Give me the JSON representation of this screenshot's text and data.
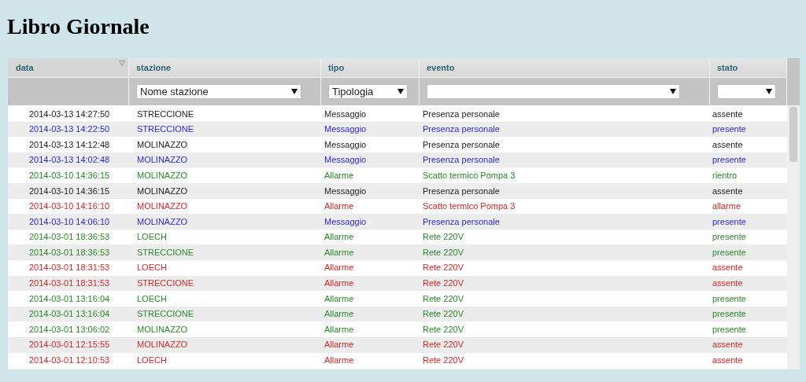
{
  "title": "Libro Giornale",
  "columns": [
    {
      "label": "data",
      "sorted": true
    },
    {
      "label": "stazione",
      "sorted": false,
      "filter": {
        "kind": "select",
        "value": "Nome stazione"
      }
    },
    {
      "label": "tipo",
      "sorted": false,
      "filter": {
        "kind": "select",
        "value": "Tipologia"
      }
    },
    {
      "label": "evento",
      "sorted": false,
      "filter": {
        "kind": "select"
      }
    },
    {
      "label": "stato",
      "sorted": false,
      "filter": {
        "kind": "select"
      }
    }
  ],
  "rows": [
    {
      "color": "#222222",
      "cells": [
        "2014-03-13 14:27:50",
        "STRECCIONE",
        "Messaggio",
        "Presenza personale",
        "assente"
      ]
    },
    {
      "color": "#2a2acc",
      "cells": [
        "2014-03-13 14:22:50",
        "STRECCIONE",
        "Messaggio",
        "Presenza personale",
        "presente"
      ]
    },
    {
      "color": "#222222",
      "cells": [
        "2014-03-13 14:12:48",
        "MOLINAZZO",
        "Messaggio",
        "Presenza personale",
        "assente"
      ]
    },
    {
      "color": "#2a2acc",
      "cells": [
        "2014-03-13 14:02:48",
        "MOLINAZZO",
        "Messaggio",
        "Presenza personale",
        "presente"
      ]
    },
    {
      "color": "#2a8a2a",
      "cells": [
        "2014-03-10 14:36:15",
        "MOLINAZZO",
        "Allarme",
        "Scatto termico Pompa 3",
        "rientro"
      ]
    },
    {
      "color": "#222222",
      "cells": [
        "2014-03-10 14:36:15",
        "MOLINAZZO",
        "Messaggio",
        "Presenza personale",
        "assente"
      ]
    },
    {
      "color": "#d42a2a",
      "cells": [
        "2014-03-10 14:16:10",
        "MOLINAZZO",
        "Allarme",
        "Scatto termico Pompa 3",
        "allarme"
      ]
    },
    {
      "color": "#2a2acc",
      "cells": [
        "2014-03-10 14:06:10",
        "MOLINAZZO",
        "Messaggio",
        "Presenza personale",
        "presente"
      ]
    },
    {
      "color": "#2a8a2a",
      "cells": [
        "2014-03-01 18:36:53",
        "LOECH",
        "Allarme",
        "Rete 220V",
        "presente"
      ]
    },
    {
      "color": "#2a8a2a",
      "cells": [
        "2014-03-01 18:36:53",
        "STRECCIONE",
        "Allarme",
        "Rete 220V",
        "presente"
      ]
    },
    {
      "color": "#d42a2a",
      "cells": [
        "2014-03-01 18:31:53",
        "LOECH",
        "Allarme",
        "Rete 220V",
        "assente"
      ]
    },
    {
      "color": "#d42a2a",
      "cells": [
        "2014-03-01 18:31:53",
        "STRECCIONE",
        "Allarme",
        "Rete 220V",
        "assente"
      ]
    },
    {
      "color": "#2a8a2a",
      "cells": [
        "2014-03-01 13:16:04",
        "LOECH",
        "Allarme",
        "Rete 220V",
        "presente"
      ]
    },
    {
      "color": "#2a8a2a",
      "cells": [
        "2014-03-01 13:16:04",
        "STRECCIONE",
        "Allarme",
        "Rete 220V",
        "presente"
      ]
    },
    {
      "color": "#2a8a2a",
      "cells": [
        "2014-03-01 13:06:02",
        "MOLINAZZO",
        "Allarme",
        "Rete 220V",
        "presente"
      ]
    },
    {
      "color": "#d42a2a",
      "cells": [
        "2014-03-01 12:15:55",
        "MOLINAZZO",
        "Allarme",
        "Rete 220V",
        "assente"
      ]
    },
    {
      "color": "#d42a2a",
      "cells": [
        "2014-03-01 12:10:53",
        "LOECH",
        "Allarme",
        "Rete 220V",
        "assente"
      ]
    }
  ]
}
